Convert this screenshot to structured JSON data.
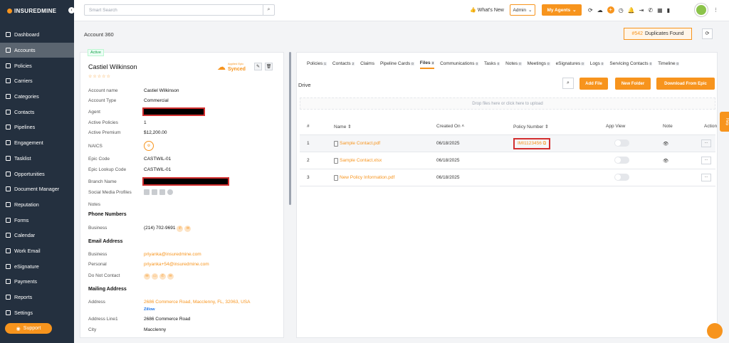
{
  "brand": {
    "logo_text": "INSUREDMINE",
    "accent": "#f7941d"
  },
  "sidebar": {
    "items": [
      {
        "label": "Dashboard",
        "icon": "dashboard-icon"
      },
      {
        "label": "Accounts",
        "icon": "accounts-icon",
        "active": true
      },
      {
        "label": "Policies",
        "icon": "policies-icon"
      },
      {
        "label": "Carriers",
        "icon": "carriers-icon"
      },
      {
        "label": "Categories",
        "icon": "categories-icon"
      },
      {
        "label": "Contacts",
        "icon": "contacts-icon"
      },
      {
        "label": "Pipelines",
        "icon": "pipelines-icon"
      },
      {
        "label": "Engagement",
        "icon": "engagement-icon"
      },
      {
        "label": "Tasklist",
        "icon": "tasklist-icon"
      },
      {
        "label": "Opportunities",
        "icon": "opportunities-icon"
      },
      {
        "label": "Document Manager",
        "icon": "folder-icon"
      },
      {
        "label": "Reputation",
        "icon": "reputation-icon"
      },
      {
        "label": "Forms",
        "icon": "forms-icon"
      },
      {
        "label": "Calendar",
        "icon": "calendar-icon"
      },
      {
        "label": "Work Email",
        "icon": "email-icon"
      },
      {
        "label": "eSignature",
        "icon": "esignature-icon"
      },
      {
        "label": "Payments",
        "icon": "payments-icon"
      },
      {
        "label": "Reports",
        "icon": "reports-icon"
      },
      {
        "label": "Settings",
        "icon": "settings-icon"
      }
    ],
    "support_label": "Support"
  },
  "topbar": {
    "search_placeholder": "Smart Search",
    "whats_new": "What's New",
    "admin_label": "Admin",
    "my_agents_label": "My Agents"
  },
  "page": {
    "title": "Account 360",
    "duplicates_count": "#542",
    "duplicates_label": "Duplicates Found"
  },
  "account": {
    "status": "Active",
    "name": "Castiel Wilkinson",
    "sync_small": "Applied Epic",
    "sync_label": "Synced",
    "fields": [
      {
        "label": "Account name",
        "value": "Castiel Wilkinson"
      },
      {
        "label": "Account Type",
        "value": "Commercial"
      },
      {
        "label": "Agent",
        "value": ""
      },
      {
        "label": "Active Policies",
        "value": "1"
      },
      {
        "label": "Active Premium",
        "value": "$12,200.00"
      },
      {
        "label": "NAICS",
        "value": ""
      },
      {
        "label": "Epic Code",
        "value": "CASTWIL-01"
      },
      {
        "label": "Epic Lookup Code",
        "value": "CASTWIL-01"
      },
      {
        "label": "Branch Name",
        "value": ""
      },
      {
        "label": "Social Media Profiles",
        "value": ""
      },
      {
        "label": "Notes",
        "value": ""
      }
    ],
    "phone_section": "Phone Numbers",
    "phone_label": "Business",
    "phone_value": "(214) 702-9691",
    "email_section": "Email Address",
    "email_business_label": "Business",
    "email_business": "priyanka@insuredmine.com",
    "email_personal_label": "Personal",
    "email_personal": "priyanka+54@insuredmine.com",
    "dnc_label": "Do Not Contact",
    "mailing_section": "Mailing Address",
    "address_label": "Address",
    "address_value": "2686 Commerce Road, Macclenny, FL, 32063, USA",
    "zillow": "Zillow",
    "address1_label": "Address Line1",
    "address1_value": "2686 Commerce Road",
    "city_label": "City",
    "city_value": "Macclenny"
  },
  "tabs": [
    {
      "label": "Policies",
      "count": "1"
    },
    {
      "label": "Contacts",
      "count": "2"
    },
    {
      "label": "Claims",
      "count": ""
    },
    {
      "label": "Pipeline Cards",
      "count": "0"
    },
    {
      "label": "Files",
      "count": "3",
      "active": true
    },
    {
      "label": "Communications",
      "count": "0"
    },
    {
      "label": "Tasks",
      "count": "0"
    },
    {
      "label": "Notes",
      "count": "0"
    },
    {
      "label": "Meetings",
      "count": "0"
    },
    {
      "label": "eSignatures",
      "count": "0"
    },
    {
      "label": "Logs",
      "count": "0"
    },
    {
      "label": "Servicing Contacts",
      "count": "0"
    },
    {
      "label": "Timeline",
      "count": "0"
    }
  ],
  "drive": {
    "title": "Drive",
    "add_file": "Add File",
    "new_folder": "New Folder",
    "download_epic": "Download From Epic",
    "drop_text": "Drop files here or click here to upload",
    "columns": [
      "#",
      "Name",
      "Created On",
      "Policy Number",
      "App View",
      "Note",
      "Action"
    ],
    "rows": [
      {
        "num": "1",
        "name": "Sample Contact.pdf",
        "created": "06/18/2025",
        "policy": "IMI1123456"
      },
      {
        "num": "2",
        "name": "Sample Contact.xlsx",
        "created": "06/18/2025",
        "policy": ""
      },
      {
        "num": "3",
        "name": "New Policy Information.pdf",
        "created": "06/18/2025",
        "policy": ""
      }
    ]
  },
  "help_tab": "Help"
}
